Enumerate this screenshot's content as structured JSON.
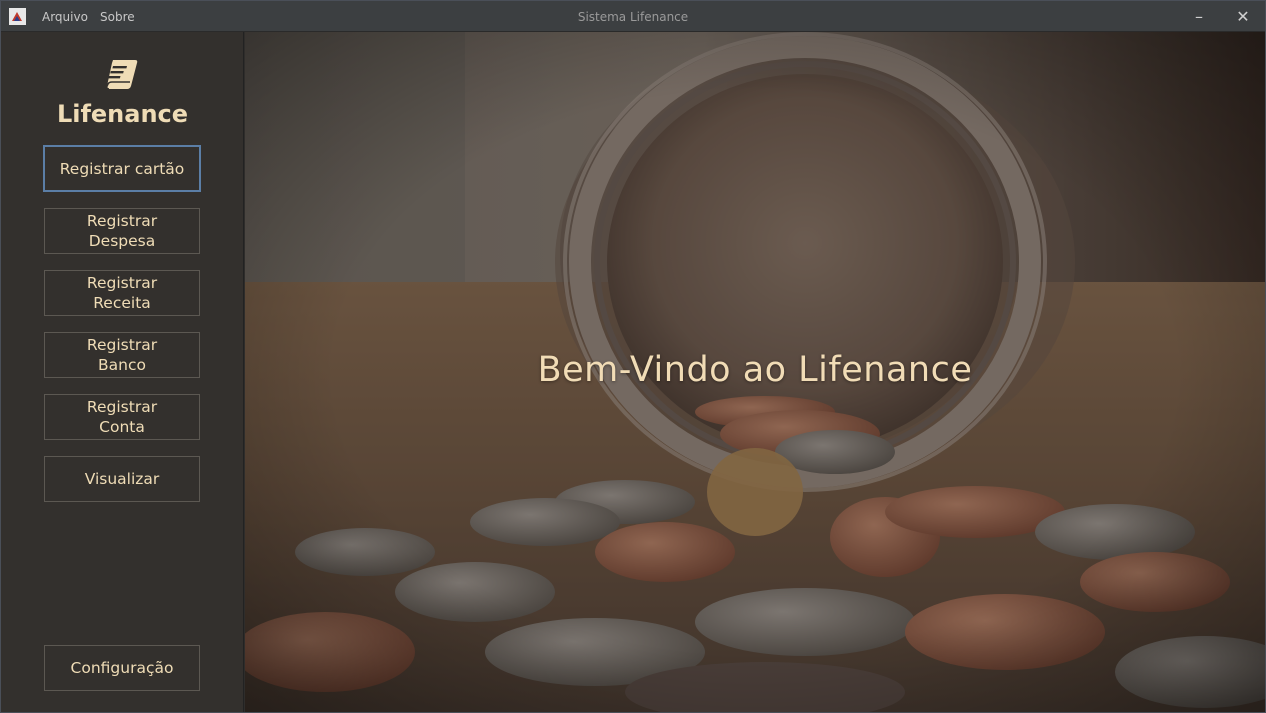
{
  "window": {
    "title": "Sistema Lifenance",
    "minimize_glyph": "–",
    "close_glyph": "✕"
  },
  "menu": {
    "items": [
      {
        "label": "Arquivo"
      },
      {
        "label": "Sobre"
      }
    ]
  },
  "sidebar": {
    "brand": "Lifenance",
    "logo_icon": "book-icon",
    "buttons": [
      {
        "line1": "Registrar cartão",
        "line2": ""
      },
      {
        "line1": "Registrar",
        "line2": "Despesa"
      },
      {
        "line1": "Registrar",
        "line2": "Receita"
      },
      {
        "line1": "Registrar",
        "line2": "Banco"
      },
      {
        "line1": "Registrar",
        "line2": "Conta"
      },
      {
        "line1": "Visualizar",
        "line2": ""
      }
    ],
    "config_label": "Configuração"
  },
  "main": {
    "welcome": "Bem-Vindo ao Lifenance",
    "background_image": "coin-jar-photo"
  },
  "colors": {
    "accent_text": "#efdcb6",
    "focus_border": "#5b7ea6",
    "sidebar_bg": "#33302d",
    "titlebar_bg": "#3c3f41"
  }
}
